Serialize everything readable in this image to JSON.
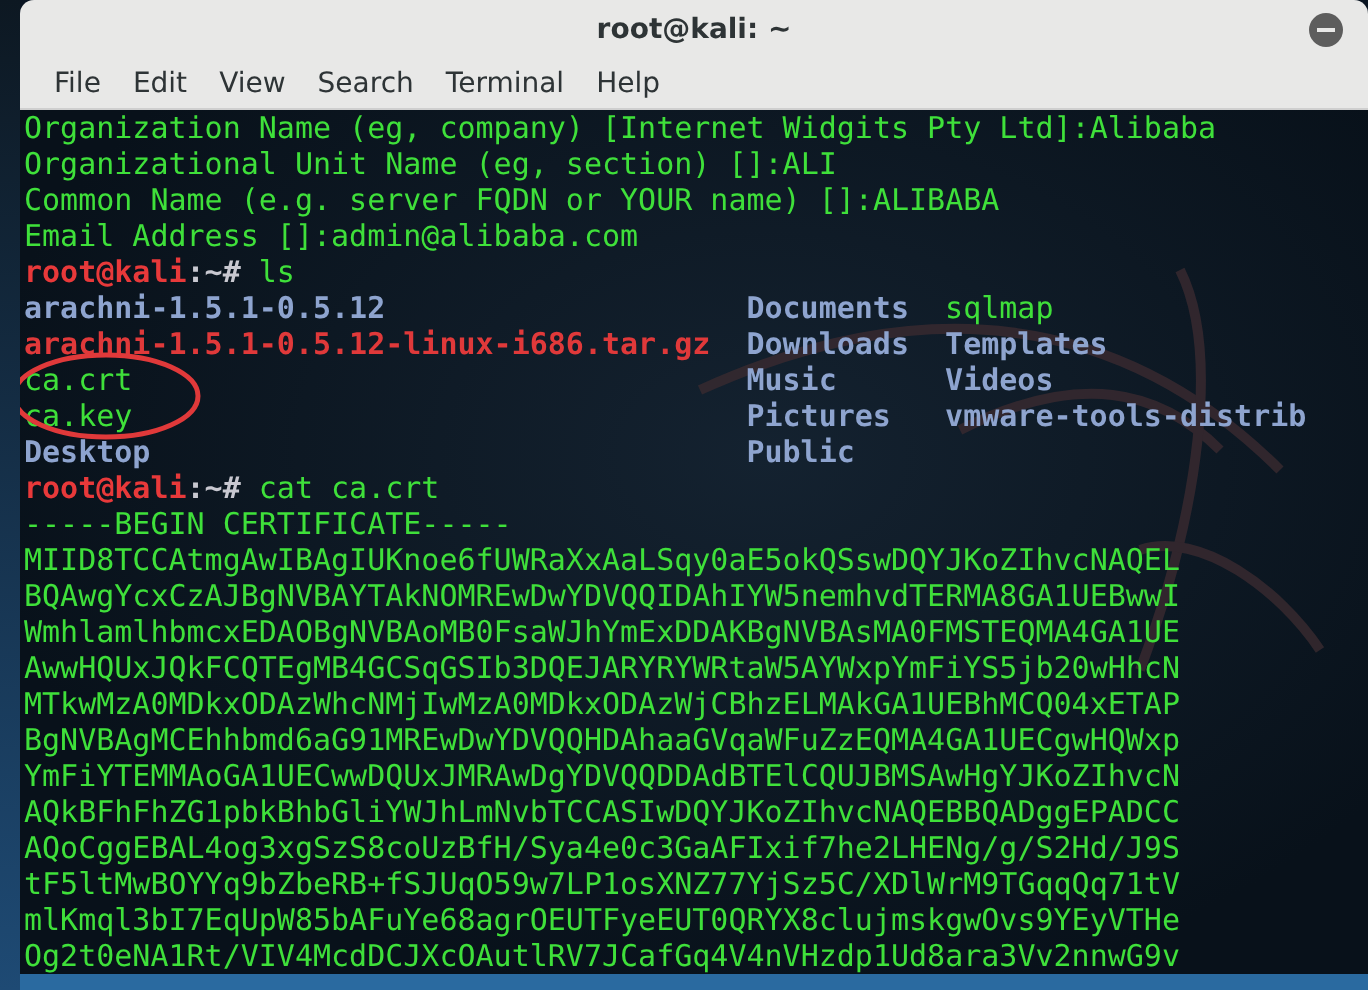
{
  "window": {
    "title": "root@kali: ~"
  },
  "menu": [
    {
      "label": "File"
    },
    {
      "label": "Edit"
    },
    {
      "label": "View"
    },
    {
      "label": "Search"
    },
    {
      "label": "Terminal"
    },
    {
      "label": "Help"
    }
  ],
  "terminal": [
    {
      "kind": "output",
      "text": "Organization Name (eg, company) [Internet Widgits Pty Ltd]:Alibaba"
    },
    {
      "kind": "output",
      "text": "Organizational Unit Name (eg, section) []:ALI"
    },
    {
      "kind": "output",
      "text": "Common Name (e.g. server FQDN or YOUR name) []:ALIBABA"
    },
    {
      "kind": "output",
      "text": "Email Address []:admin@alibaba.com"
    },
    {
      "kind": "prompt",
      "user": "root@kali",
      "path": ":~#",
      "command": "ls"
    },
    {
      "kind": "listing",
      "entries": [
        {
          "name": "arachni-1.5.1-0.5.12",
          "kind": "directory"
        },
        {
          "name": "arachni-1.5.1-0.5.12-linux-i686.tar.gz",
          "kind": "archive"
        },
        {
          "name": "ca.crt",
          "kind": "file"
        },
        {
          "name": "ca.key",
          "kind": "file"
        },
        {
          "name": "Desktop",
          "kind": "directory"
        },
        {
          "name": "Documents",
          "kind": "directory"
        },
        {
          "name": "Downloads",
          "kind": "directory"
        },
        {
          "name": "Music",
          "kind": "directory"
        },
        {
          "name": "Pictures",
          "kind": "directory"
        },
        {
          "name": "Public",
          "kind": "directory"
        },
        {
          "name": "sqlmap",
          "kind": "file"
        },
        {
          "name": "Templates",
          "kind": "directory"
        },
        {
          "name": "Videos",
          "kind": "directory"
        },
        {
          "name": "vmware-tools-distrib",
          "kind": "directory"
        }
      ]
    },
    {
      "kind": "prompt",
      "user": "root@kali",
      "path": ":~#",
      "command": "cat ca.crt"
    },
    {
      "kind": "output",
      "text": "-----BEGIN CERTIFICATE-----"
    },
    {
      "kind": "output",
      "text": "MIID8TCCAtmgAwIBAgIUKnoe6fUWRaXxAaLSqy0aE5okQSswDQYJKoZIhvcNAQEL"
    },
    {
      "kind": "output",
      "text": "BQAwgYcxCzAJBgNVBAYTAkNOMREwDwYDVQQIDAhIYW5nemhvdTERMA8GA1UEBwwI"
    },
    {
      "kind": "output",
      "text": "WmhlamlhbmcxEDAOBgNVBAoMB0FsaWJhYmExDDAKBgNVBAsMA0FMSTEQMA4GA1UE"
    },
    {
      "kind": "output",
      "text": "AwwHQUxJQkFCQTEgMB4GCSqGSIb3DQEJARYRYWRtaW5AYWxpYmFiYS5jb20wHhcN"
    },
    {
      "kind": "output",
      "text": "MTkwMzA0MDkxODAzWhcNMjIwMzA0MDkxODAzWjCBhzELMAkGA1UEBhMCQ04xETAP"
    },
    {
      "kind": "output",
      "text": "BgNVBAgMCEhhbmd6aG91MREwDwYDVQQHDAhaaGVqaWFuZzEQMA4GA1UECgwHQWxp"
    },
    {
      "kind": "output",
      "text": "YmFiYTEMMAoGA1UECwwDQUxJMRAwDgYDVQQDDAdBTElCQUJBMSAwHgYJKoZIhvcN"
    },
    {
      "kind": "output",
      "text": "AQkBFhFhZG1pbkBhbGliYWJhLmNvbTCCASIwDQYJKoZIhvcNAQEBBQADggEPADCC"
    },
    {
      "kind": "output",
      "text": "AQoCggEBAL4og3xgSzS8coUzBfH/Sya4e0c3GaAFIxif7he2LHENg/g/S2Hd/J9S"
    },
    {
      "kind": "output",
      "text": "tF5ltMwBOYYq9bZbeRB+fSJUqO59w7LP1osXNZ77YjSz5C/XDlWrM9TGqqQq71tV"
    },
    {
      "kind": "output",
      "text": "mlKmql3bI7EqUpW85bAFuYe68agrOEUTFyeEUT0QRYX8clujmskgwOvs9YEyVTHe"
    },
    {
      "kind": "output",
      "text": "Og2t0eNA1Rt/VIV4McdDCJXcOAutlRV7JCafGq4V4nVHzdp1Ud8ara3Vv2nnwG9v"
    }
  ]
}
